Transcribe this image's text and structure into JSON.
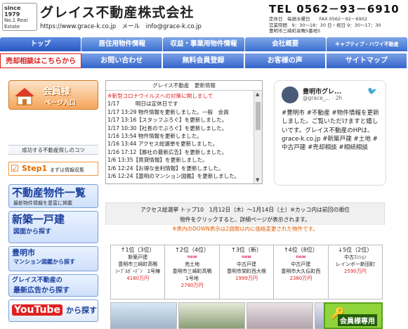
{
  "header": {
    "logo_year": "since 1979",
    "logo_tagline": "No.1 Real Estate",
    "company_name": "グレイス不動産株式会社",
    "url_line": "https://www.grace-k.co.jp　メール　info@grace-k.co.jp",
    "tel": "TEL 0562－93－6910",
    "info_line1": "定休日　毎週水曜日　　FAX 0562－92－6902",
    "info_line2": "営業時間　9：30～18：30 日・祝日 9：30～17：30",
    "info_line3": "豊明市三崎町高鴨5番地5"
  },
  "nav1": [
    "トップ",
    "居住用物件情報",
    "収益・事業用物件情報",
    "会社概要",
    "キャプティブ・ハワイ不動産"
  ],
  "nav2": [
    "売却相談はこちらから",
    "お問い合わせ",
    "無料会員登録",
    "お客様の声",
    "サイトマップ"
  ],
  "side": {
    "kaiin_title": "会員様",
    "kaiin_sub": "ページ入口",
    "kotsu": "成功する不動産探しのコツ",
    "step1_label": "Step1",
    "step1_sub": "まずは情報収集",
    "banner1_big": "不動産物件一覧",
    "banner1_small": "最新物件情報を豊富に掲載",
    "banner2_big": "新築一戸建",
    "banner2_small": "図面から探す",
    "banner3_big": "豊明市",
    "banner3_small": "マンション図鑑から探す",
    "banner4_big": "グレイス不動産の",
    "banner4_small": "最新広告から探す",
    "banner5_big": "YouTube",
    "banner5_small": "から探す"
  },
  "news": {
    "head": "グレイス不動産　更新情報",
    "lines": [
      {
        "t": "※新型コロナウイルスへの対策に関しまして",
        "red": true
      },
      {
        "t": "1/17　　　明日は定休日です"
      },
      {
        "t": "1/17 13:29 物件情報を更新しました。一般　会員"
      },
      {
        "t": "1/17 13:16【スタッフぶろぐ】を更新しました。"
      },
      {
        "t": "1/17 10:30【社長のでぶろぐ】を更新しました。"
      },
      {
        "t": "1/16 13:54 物件情報を更新しました。"
      },
      {
        "t": "1/16 13:44 アクセス総選挙を更新しました。"
      },
      {
        "t": "1/16 17:12【豚社の最新広告】を更新しました。"
      },
      {
        "t": "1/6 13:35【賃貸情報】を更新しました。"
      },
      {
        "t": "1/6 12:24【お得な金利情報】を更新しました。"
      },
      {
        "t": "1/6 12:24【豊明のマンション図鑑】を更新しました。"
      }
    ]
  },
  "tweet": {
    "name": "豊明市グレ...",
    "handle": "@grace_... · 2h",
    "text": "#豊明市 #不動産 #物件情報を更新しました。ご覧いただけますと嬉しいです。グレイス不動産のHPは、grace-k.co.jp #新築戸建 #土地 #中古戸建 #売却相談 #相続相談"
  },
  "ranking": {
    "line1": "アクセス総選挙 トップ10　1月12日（木）～1月14日（土）※カッコ内は前回の順位",
    "line2": "物件をクリックすると、詳細ページが表示されます。",
    "note": "※表内のDOWN表示は2週間以内に価格変更された物件です。"
  },
  "properties": [
    {
      "rank": "↑1位（3位）",
      "new": "",
      "type": "新築戸建",
      "addr": "豊明市三崎町高鴨",
      "name": "ｼｰﾌﾞﾙｶﾞｰﾃﾞﾝ　1号棟",
      "price": "4180万円"
    },
    {
      "rank": "↑2位（4位）",
      "new": "new",
      "type": "売土地",
      "addr": "豊明市三崎町高鴨",
      "name": "1号地",
      "price": "2780万円"
    },
    {
      "rank": "↑3位（新）",
      "new": "new",
      "type": "中古戸建",
      "addr": "豊明市栄町西大根",
      "name": "",
      "price": "1999万円"
    },
    {
      "rank": "↑4位（8位）",
      "new": "new",
      "type": "中古戸建",
      "addr": "豊明市大久伝町西",
      "name": "",
      "price": "2380万円"
    },
    {
      "rank": "↓5位（2位）",
      "new": "",
      "type": "中古ﾏﾝｼｮﾝ",
      "addr": "レインボー新田町",
      "name": "",
      "price": "2590万円"
    }
  ],
  "member_box": "会員様専用"
}
